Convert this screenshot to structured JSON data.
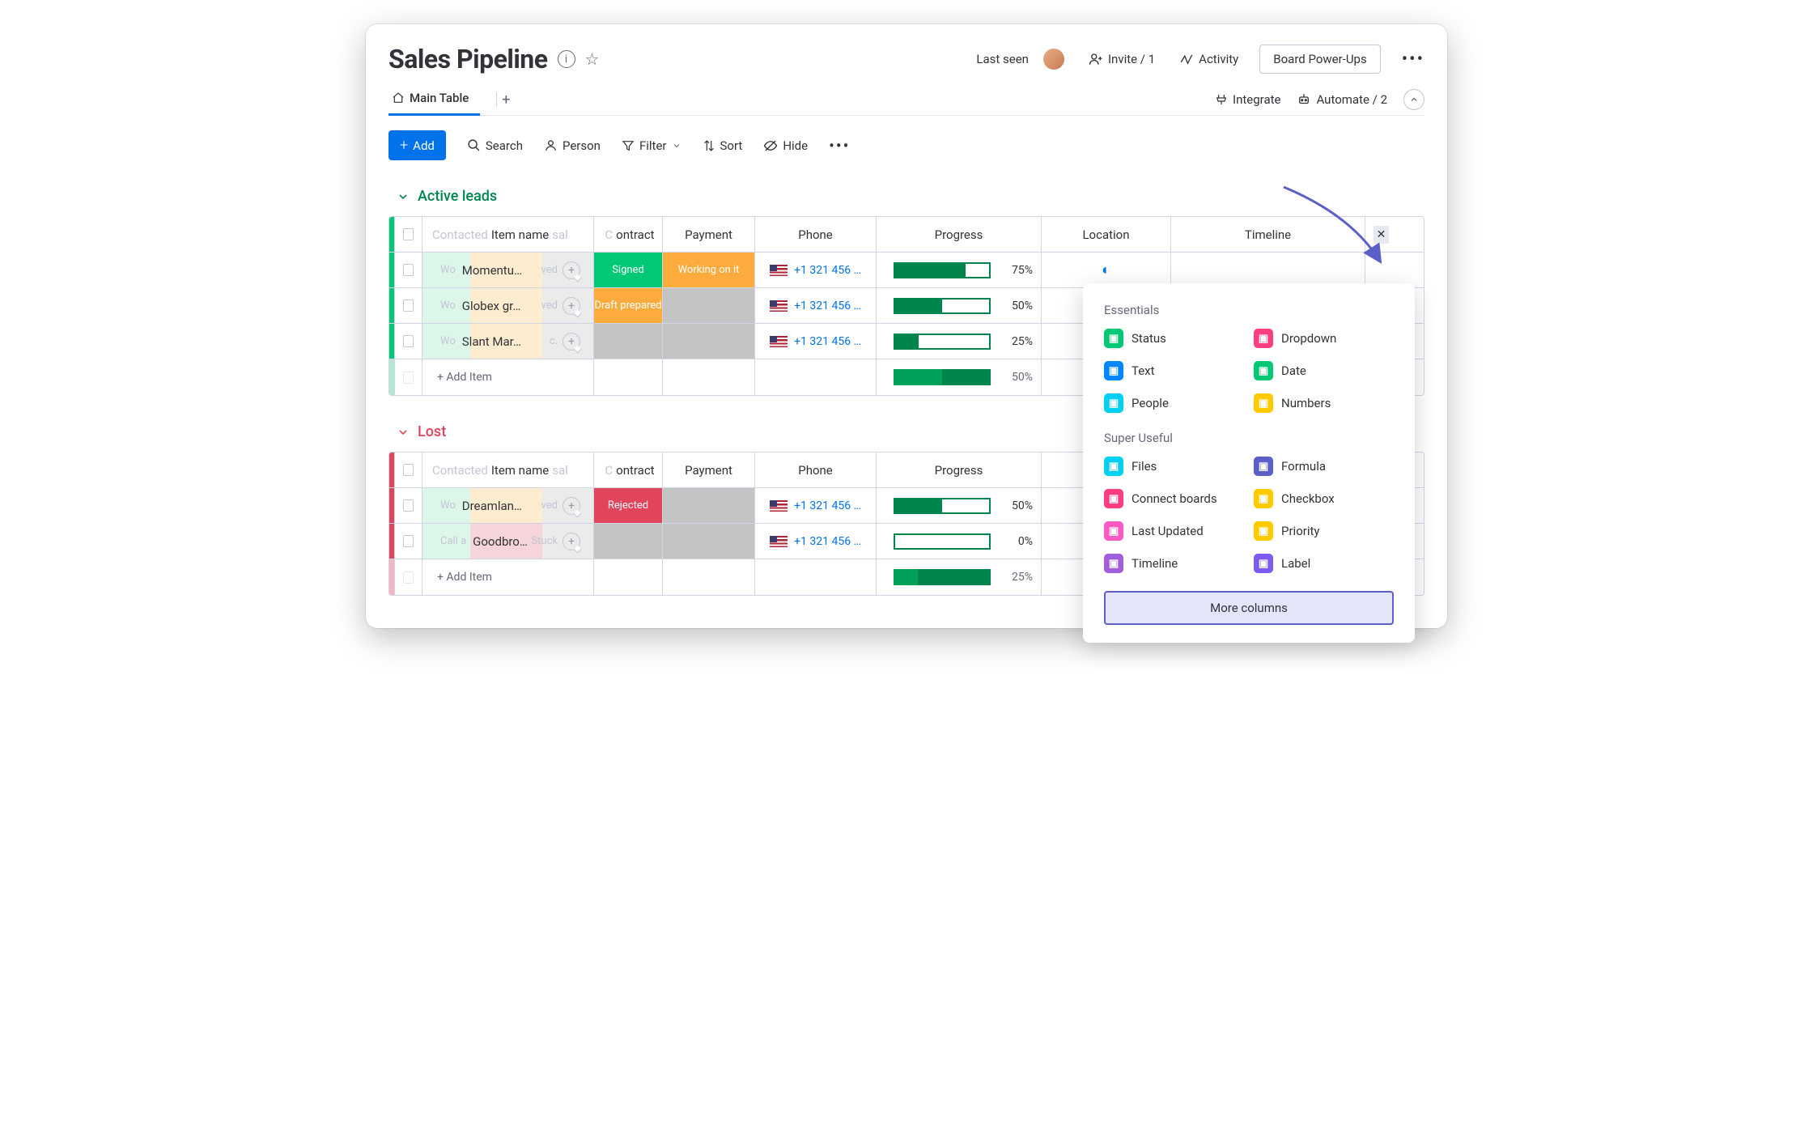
{
  "header": {
    "title": "Sales Pipeline",
    "last_seen": "Last seen",
    "invite": "Invite / 1",
    "activity": "Activity",
    "powerups": "Board Power-Ups"
  },
  "tabs": {
    "main": "Main Table",
    "integrate": "Integrate",
    "automate": "Automate / 2"
  },
  "toolbar": {
    "add": "Add",
    "search": "Search",
    "person": "Person",
    "filter": "Filter",
    "sort": "Sort",
    "hide": "Hide"
  },
  "columns": {
    "contacted_ghost": "Contacted",
    "item": "Item name",
    "sal_ghost": "sal",
    "c_ghost": "C",
    "contract": "ontract",
    "payment": "Payment",
    "phone": "Phone",
    "progress": "Progress",
    "location": "Location",
    "timeline": "Timeline"
  },
  "groups": [
    {
      "key": "active",
      "title": "Active leads",
      "color": "green",
      "rows": [
        {
          "ghost_pre": "Wo",
          "name": "Momentu…",
          "ghost_post": "ved",
          "contract": {
            "label": "Signed",
            "color": "bg-signed"
          },
          "payment": {
            "label": "Working on it",
            "color": "bg-work"
          },
          "phone": "+1 321 456 …",
          "progress": 75,
          "location": true
        },
        {
          "ghost_pre": "Wo",
          "name": "Globex gr…",
          "ghost_post": "ved",
          "contract": {
            "label": "Draft prepared",
            "color": "bg-draft"
          },
          "payment": {
            "label": "",
            "color": "bg-gray"
          },
          "phone": "+1 321 456 …",
          "progress": 50,
          "location": false
        },
        {
          "ghost_pre": "Wo",
          "name": "Slant Mar…",
          "ghost_post": "c.",
          "contract": {
            "label": "",
            "color": "bg-gray"
          },
          "payment": {
            "label": "",
            "color": "bg-gray"
          },
          "phone": "+1 321 456 …",
          "progress": 25,
          "location": true
        }
      ],
      "add_item": "+ Add Item",
      "summary_progress": 50
    },
    {
      "key": "lost",
      "title": "Lost",
      "color": "red",
      "rows": [
        {
          "ghost_pre": "Wo",
          "name": "Dreamlan…",
          "ghost_post": "ved",
          "contract": {
            "label": "Rejected",
            "color": "bg-reject"
          },
          "payment": {
            "label": "",
            "color": "bg-gray"
          },
          "phone": "+1 321 456 …",
          "progress": 50,
          "location": true
        },
        {
          "ghost_pre": "Call a",
          "name": "Goodbrot…",
          "ghost_post": "Stuck",
          "contract": {
            "label": "",
            "color": "bg-gray"
          },
          "payment": {
            "label": "",
            "color": "bg-gray"
          },
          "phone": "+1 321 456 …",
          "progress": 0,
          "location": true
        }
      ],
      "add_item": "+ Add Item",
      "summary_progress": 25
    }
  ],
  "popover": {
    "essentials_title": "Essentials",
    "essentials": [
      {
        "label": "Status",
        "bg": "#00c875"
      },
      {
        "label": "Dropdown",
        "bg": "#ff3d82"
      },
      {
        "label": "Text",
        "bg": "#0086ff"
      },
      {
        "label": "Date",
        "bg": "#00c875"
      },
      {
        "label": "People",
        "bg": "#00cff4"
      },
      {
        "label": "Numbers",
        "bg": "#ffcb00"
      }
    ],
    "super_title": "Super Useful",
    "super": [
      {
        "label": "Files",
        "bg": "#00cff4"
      },
      {
        "label": "Formula",
        "bg": "#5b5fc7"
      },
      {
        "label": "Connect boards",
        "bg": "#ff3d82"
      },
      {
        "label": "Checkbox",
        "bg": "#ffcb00"
      },
      {
        "label": "Last Updated",
        "bg": "#ff5ac4"
      },
      {
        "label": "Priority",
        "bg": "#ffcb00"
      },
      {
        "label": "Timeline",
        "bg": "#a25ddc"
      },
      {
        "label": "Label",
        "bg": "#7e5bef"
      }
    ],
    "more": "More columns"
  }
}
